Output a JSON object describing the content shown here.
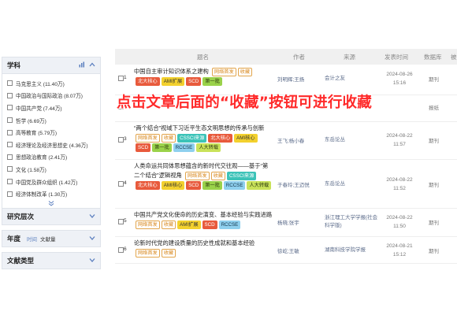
{
  "sidebar": {
    "subject_header": "学科",
    "subjects": [
      "马克思主义 (11.40万)",
      "中国政治与国际政治 (8.07万)",
      "中国共产党 (7.44万)",
      "哲学 (6.69万)",
      "高等教育 (5.79万)",
      "经济理论及经济思想史 (4.36万)",
      "思想政治教育 (2.41万)",
      "文化 (1.58万)",
      "中国党及群众组织 (1.42万)",
      "经济体制改革 (1.30万)"
    ],
    "level_header": "研究层次",
    "year_header": "年度",
    "year_sort_time": "时间",
    "year_sort_count": "文献量",
    "doctype_header": "文献类型"
  },
  "table": {
    "headers": {
      "title": "题名",
      "author": "作者",
      "source": "来源",
      "date": "发表时间",
      "db": "数据库",
      "cite": "被"
    },
    "rows": [
      {
        "num": "1",
        "title": "中国自主审计知识体系之建构",
        "author": "刘明辉;王扬",
        "source": "会计之友",
        "date": "2024-08-26",
        "time": "15:16",
        "db": "期刊",
        "tags": [
          [
            "网络首发",
            "outline"
          ],
          [
            "收藏",
            "outline"
          ],
          [
            "北大核心",
            "red"
          ],
          [
            "AMI扩展",
            "yellow"
          ],
          [
            "SCD",
            "red"
          ],
          [
            "第一批",
            "green"
          ]
        ]
      },
      {
        "num": "2",
        "title": "",
        "author": "",
        "source": "",
        "date": "",
        "time": "",
        "db": "报纸",
        "tags": []
      },
      {
        "num": "3",
        "title": "“两个结合”视域下习近平生态文明思想的传承与创新",
        "author": "王飞;杨小春",
        "source": "东岳论丛",
        "date": "2024-08-22",
        "time": "11:57",
        "db": "期刊",
        "tags": [
          [
            "网络首发",
            "outline"
          ],
          [
            "收藏",
            "outline"
          ],
          [
            "CSSCI来源",
            "teal"
          ],
          [
            "北大核心",
            "red"
          ],
          [
            "AMI核心",
            "yellow"
          ],
          [
            "SCD",
            "red"
          ],
          [
            "第一批",
            "green"
          ],
          [
            "RCCSE",
            "blue"
          ],
          [
            "人大转载",
            "lime"
          ]
        ]
      },
      {
        "num": "4",
        "title": "人类命运共同体思想蕴含的新时代交往观——基于“第二个结合”逻辑视角",
        "author": "于春玲;王迈悦",
        "source": "东岳论丛",
        "date": "2024-08-22",
        "time": "11:52",
        "db": "期刊",
        "tags": [
          [
            "网络首发",
            "outline"
          ],
          [
            "收藏",
            "outline"
          ],
          [
            "CSSCI来源",
            "teal"
          ],
          [
            "北大核心",
            "red"
          ],
          [
            "AMI核心",
            "yellow"
          ],
          [
            "SCD",
            "red"
          ],
          [
            "第一批",
            "green"
          ],
          [
            "RCCSE",
            "blue"
          ],
          [
            "人大转载",
            "lime"
          ]
        ]
      },
      {
        "num": "5",
        "title": "中国共产党文化使命的历史演变、基本经验与实践进路",
        "author": "杨晓;张宇",
        "source": "浙江理工大学学报(社会科学版)",
        "date": "2024-08-22",
        "time": "11:50",
        "db": "期刊",
        "tags": [
          [
            "网络首发",
            "outline"
          ],
          [
            "收藏",
            "outline"
          ],
          [
            "AMI扩展",
            "yellow"
          ],
          [
            "SCD",
            "red"
          ],
          [
            "RCCSE",
            "blue"
          ]
        ]
      },
      {
        "num": "6",
        "title": "论新时代党的建设质量的历史性成就和基本经验",
        "author": "徐屹;王敏",
        "source": "湖南科技学院学报",
        "date": "2024-08-21",
        "time": "15:12",
        "db": "期刊",
        "tags": [
          [
            "网络首发",
            "outline"
          ],
          [
            "收藏",
            "outline"
          ]
        ]
      }
    ]
  },
  "overlay_text": "点击文章后面的“收藏”按钮可进行收藏",
  "colors": {
    "overlay": "#ff2a2a",
    "panel_bg": "#eef1f6",
    "accent": "#5b7fbf"
  }
}
